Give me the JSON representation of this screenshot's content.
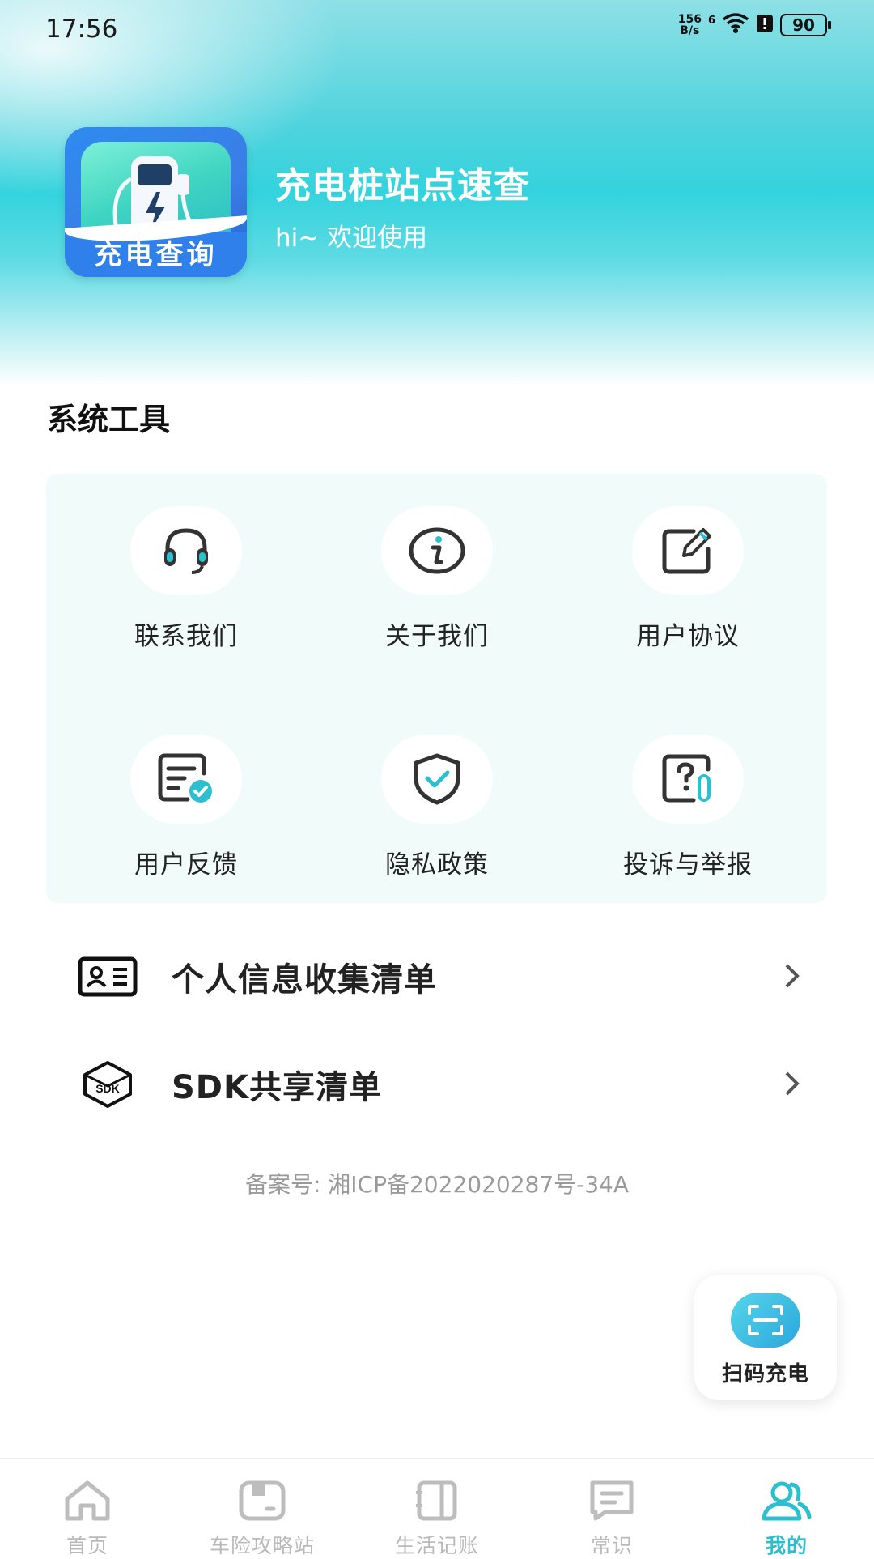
{
  "status_bar": {
    "time": "17:56",
    "net_speed": "156",
    "net_unit": "B/s",
    "signal": "6",
    "battery": "90"
  },
  "header": {
    "logo_text": "充电查询",
    "app_name": "充电桩站点速查",
    "greeting": "hi~ 欢迎使用"
  },
  "tools": {
    "title": "系统工具",
    "items": [
      {
        "label": "联系我们",
        "icon": "headset-icon"
      },
      {
        "label": "关于我们",
        "icon": "info-icon"
      },
      {
        "label": "用户协议",
        "icon": "edit-icon"
      },
      {
        "label": "用户反馈",
        "icon": "feedback-icon"
      },
      {
        "label": "隐私政策",
        "icon": "shield-check-icon"
      },
      {
        "label": "投诉与举报",
        "icon": "report-icon"
      }
    ]
  },
  "list": [
    {
      "label": "个人信息收集清单",
      "icon": "id-card-icon"
    },
    {
      "label": "SDK共享清单",
      "icon": "sdk-box-icon"
    }
  ],
  "icp": "备案号: 湘ICP备2022020287号-34A",
  "fab": {
    "label": "扫码充电",
    "icon": "scan-icon"
  },
  "tabbar": {
    "items": [
      {
        "label": "首页",
        "icon": "home-icon"
      },
      {
        "label": "车险攻略站",
        "icon": "guide-icon"
      },
      {
        "label": "生活记账",
        "icon": "ledger-icon"
      },
      {
        "label": "常识",
        "icon": "knowledge-icon"
      },
      {
        "label": "我的",
        "icon": "profile-icon"
      }
    ],
    "active_index": 4
  },
  "colors": {
    "accent": "#2bbfd0",
    "header_teal": "#33d3dd",
    "card_bg": "#f1fbfa"
  }
}
